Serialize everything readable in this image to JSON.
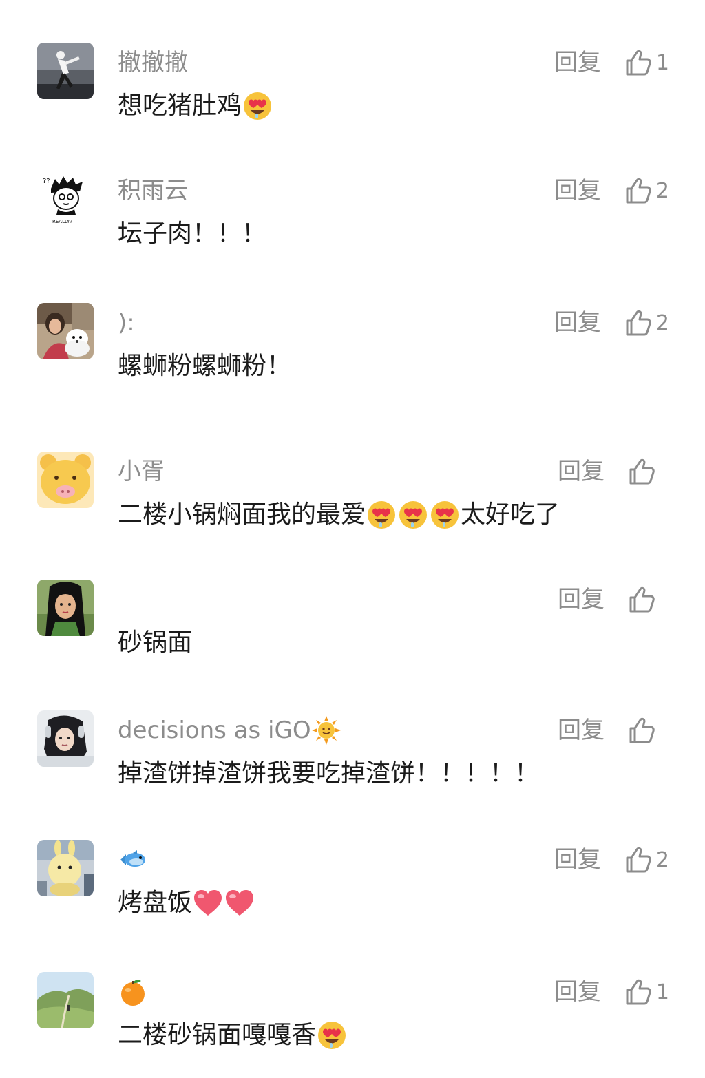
{
  "reply_label": "回复",
  "colors": {
    "username": "#8c8c8c",
    "text": "#1b1b1b",
    "icon": "#8c8c8c"
  },
  "comments": [
    {
      "username": "撤撤撤",
      "text": "想吃猪肚鸡",
      "emojis": [
        "heart-eyes-emoji"
      ],
      "likes": "1",
      "avatar": "dancer-photo-avatar"
    },
    {
      "username": "积雨云",
      "text": "坛子肉！！！",
      "emojis": [],
      "likes": "2",
      "avatar": "cartoon-boy-really-avatar"
    },
    {
      "username": "):",
      "text": "螺蛳粉螺蛳粉！",
      "emojis": [],
      "likes": "2",
      "avatar": "girl-with-dog-avatar"
    },
    {
      "username": "小胥",
      "text": "二楼小锅焖面我的最爱",
      "text_after": "太好吃了",
      "emojis": [
        "heart-eyes-emoji",
        "heart-eyes-emoji",
        "heart-eyes-emoji"
      ],
      "likes": "",
      "avatar": "yellow-bear-avatar"
    },
    {
      "username": "",
      "text": "砂锅面",
      "emojis": [],
      "likes": "",
      "avatar": "mulan-avatar"
    },
    {
      "username": "decisions as iGO",
      "username_emoji": "sun-emoji",
      "text": "掉渣饼掉渣饼我要吃掉渣饼！！！！！",
      "emojis": [],
      "likes": "",
      "avatar": "girl-headphones-avatar"
    },
    {
      "username": "",
      "username_emoji": "fish-emoji",
      "text": "烤盘饭",
      "emojis": [
        "red-heart-emoji",
        "red-heart-emoji"
      ],
      "likes": "2",
      "avatar": "plush-toy-avatar"
    },
    {
      "username": "",
      "username_emoji": "orange-emoji",
      "text": "二楼砂锅面嘎嘎香",
      "emojis": [
        "heart-eyes-emoji"
      ],
      "likes": "1",
      "avatar": "mountain-landscape-avatar"
    }
  ]
}
